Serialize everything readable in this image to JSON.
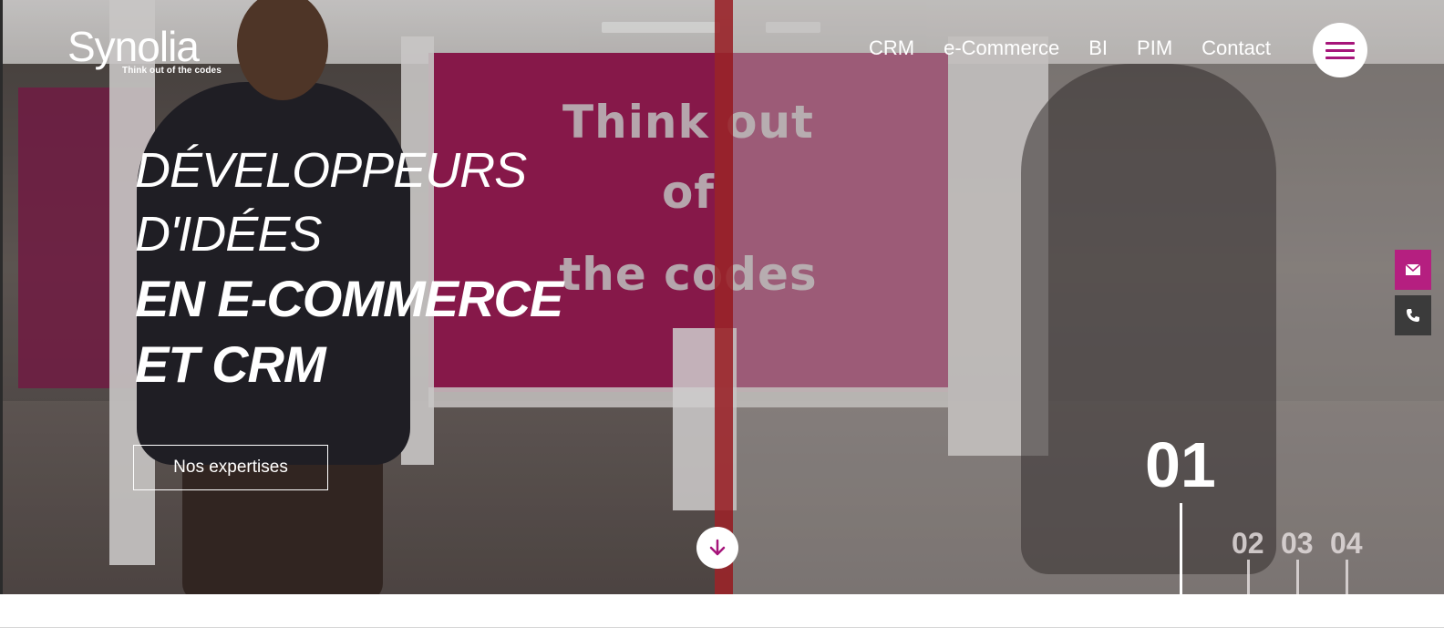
{
  "header": {
    "logo_name": "Synolia",
    "logo_tagline": "Think out of the codes",
    "nav": [
      "CRM",
      "e-Commerce",
      "BI",
      "PIM",
      "Contact"
    ],
    "menu_icon": "hamburger-icon"
  },
  "hero": {
    "wall_text": [
      "Think out",
      "of",
      "the codes"
    ],
    "headline": {
      "light_lines": [
        "DÉVELOPPEURS",
        "D'IDÉES"
      ],
      "bold_lines": [
        "EN E-COMMERCE",
        "ET CRM"
      ]
    },
    "cta_label": "Nos expertises",
    "scroll_icon": "arrow-down-icon"
  },
  "slider": {
    "current": "01",
    "others": [
      "02",
      "03",
      "04"
    ]
  },
  "side_contacts": [
    {
      "icon": "envelope-icon",
      "color": "#b51f80"
    },
    {
      "icon": "phone-icon",
      "color": "#3b3b3b"
    }
  ],
  "colors": {
    "accent": "#a6157a",
    "wall_pink": "#9c1c56"
  }
}
